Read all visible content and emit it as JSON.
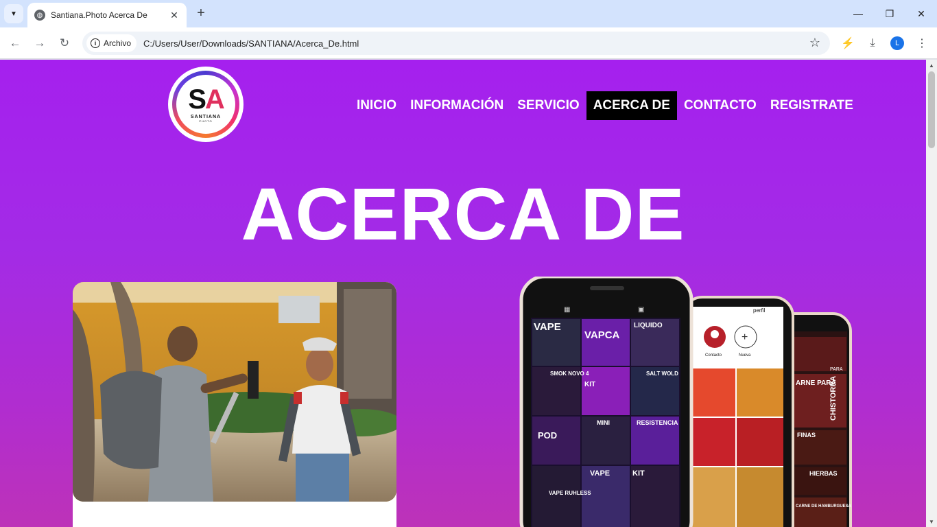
{
  "browser": {
    "tab_title": "Santiana.Photo Acerca De",
    "chip_label": "Archivo",
    "url": "C:/Users/User/Downloads/SANTIANA/Acerca_De.html",
    "profile_initial": "L"
  },
  "site": {
    "logo": {
      "mark_s": "S",
      "mark_a": "A",
      "name": "SANTIANA",
      "sub": "PHOTO"
    },
    "nav": [
      {
        "label": "INICIO",
        "active": false
      },
      {
        "label": "INFORMACIÓN",
        "active": false
      },
      {
        "label": "SERVICIO",
        "active": false
      },
      {
        "label": "ACERCA DE",
        "active": true
      },
      {
        "label": "CONTACTO",
        "active": false
      },
      {
        "label": "REGISTRATE",
        "active": false
      }
    ],
    "hero_title": "ACERCA DE",
    "phones": {
      "profile_title": "perfil",
      "highlight_contact": "Contacto",
      "highlight_new": "Nueva",
      "posts_phone1": [
        "VAPE",
        "VAPCA",
        "LIQUIDO",
        "SMOK NOVO 4",
        "KIT",
        "SALT WOLD",
        "POD",
        "MINI",
        "RESISTENCIA",
        "VAPE RUHLESS",
        "VAPE",
        "KIT"
      ],
      "posts_phone3": [
        "PARA",
        "ARNE PARA",
        "CHISTORRA",
        "FINAS",
        "HIERBAS",
        "CARNE DE HAMBURGUESA"
      ]
    }
  },
  "colors": {
    "page_bg_top": "#a520ee",
    "page_bg_bottom": "#bd32b8",
    "nav_active_bg": "#000000",
    "nav_text": "#ffffff"
  }
}
